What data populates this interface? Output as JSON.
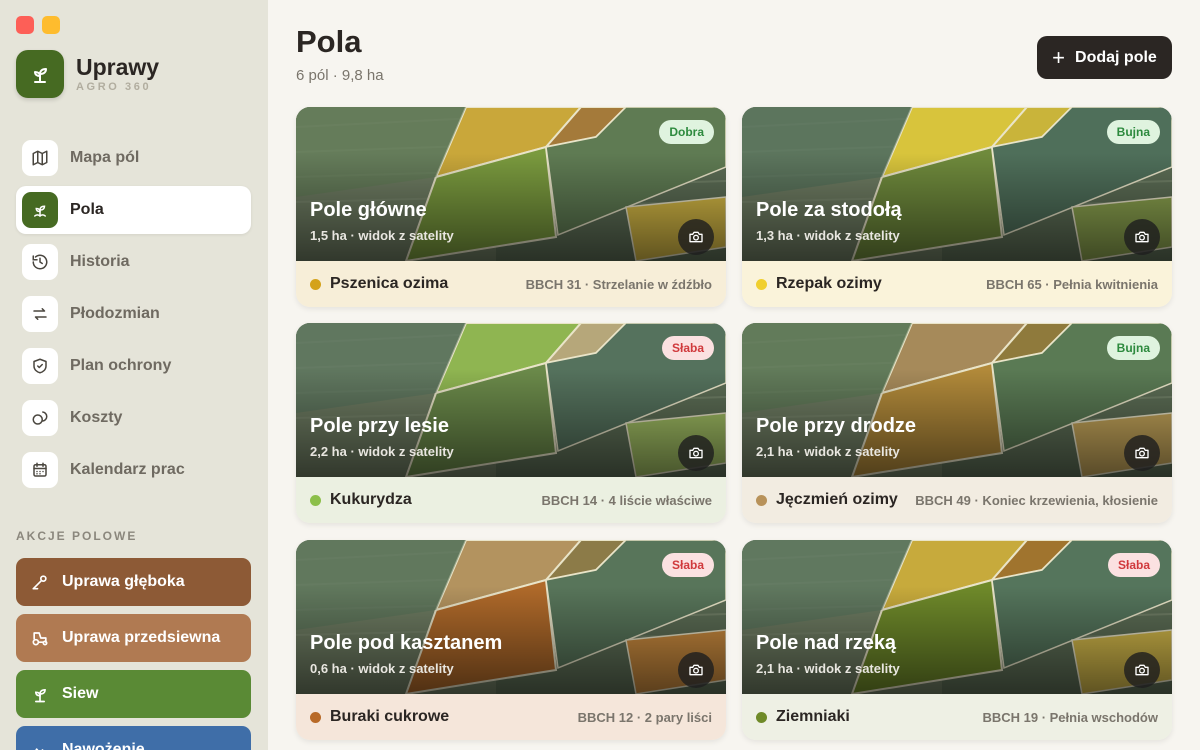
{
  "app": {
    "name": "Uprawy",
    "subtitle": "AGRO 360"
  },
  "nav": [
    {
      "label": "Mapa pól",
      "icon": "map-icon",
      "active": false
    },
    {
      "label": "Pola",
      "icon": "sprout-icon",
      "active": true
    },
    {
      "label": "Historia",
      "icon": "history-icon",
      "active": false
    },
    {
      "label": "Płodozmian",
      "icon": "rotation-arrows-icon",
      "active": false
    },
    {
      "label": "Plan ochrony",
      "icon": "shield-icon",
      "active": false
    },
    {
      "label": "Koszty",
      "icon": "coins-icon",
      "active": false
    },
    {
      "label": "Kalendarz prac",
      "icon": "calendar-icon",
      "active": false
    }
  ],
  "actions_title": "AKCJE POLOWE",
  "actions": [
    {
      "label": "Uprawa głęboka",
      "icon": "plow-icon",
      "color": "#8d5a36"
    },
    {
      "label": "Uprawa przedsiewna",
      "icon": "tractor-icon",
      "color": "#b07a52"
    },
    {
      "label": "Siew",
      "icon": "seedling-icon",
      "color": "#5a8a35"
    },
    {
      "label": "Nawożenie",
      "icon": "fertilizer-icon",
      "color": "#3f6ea8"
    }
  ],
  "header": {
    "title": "Pola",
    "subtitle": "6 pól · 9,8 ha",
    "add_button": "Dodaj pole"
  },
  "fields": [
    {
      "name": "Pole główne",
      "meta": "1,5 ha · widok z satelity",
      "status": "Dobra",
      "status_type": "good",
      "crop": "Pszenica ozima",
      "crop_color": "#d4a21b",
      "stage": "BBCH 31 · Strzelanie w źdźbło",
      "foot_bg": "#f7eed8"
    },
    {
      "name": "Pole za stodołą",
      "meta": "1,3 ha · widok z satelity",
      "status": "Bujna",
      "status_type": "good",
      "crop": "Rzepak ozimy",
      "crop_color": "#f0cf2e",
      "stage": "BBCH 65 · Pełnia kwitnienia",
      "foot_bg": "#faf3da"
    },
    {
      "name": "Pole przy lesie",
      "meta": "2,2 ha · widok z satelity",
      "status": "Słaba",
      "status_type": "weak",
      "crop": "Kukurydza",
      "crop_color": "#8cbf4a",
      "stage": "BBCH 14 · 4 liście właściwe",
      "foot_bg": "#ebf0e1"
    },
    {
      "name": "Pole przy drodze",
      "meta": "2,1 ha · widok z satelity",
      "status": "Bujna",
      "status_type": "good",
      "crop": "Jęczmień ozimy",
      "crop_color": "#b8925a",
      "stage": "BBCH 49 · Koniec krzewienia, kłosienie",
      "foot_bg": "#f2ece1"
    },
    {
      "name": "Pole pod kasztanem",
      "meta": "0,6 ha · widok z satelity",
      "status": "Słaba",
      "status_type": "weak",
      "crop": "Buraki cukrowe",
      "crop_color": "#b86a28",
      "stage": "BBCH 12 · 2 pary liści",
      "foot_bg": "#f5e6da"
    },
    {
      "name": "Pole nad rzeką",
      "meta": "2,1 ha · widok z satelity",
      "status": "Słaba",
      "status_type": "weak",
      "crop": "Ziemniaki",
      "crop_color": "#6f8a28",
      "stage": "BBCH 19 · Pełnia wschodów",
      "foot_bg": "#eef0e4"
    }
  ]
}
